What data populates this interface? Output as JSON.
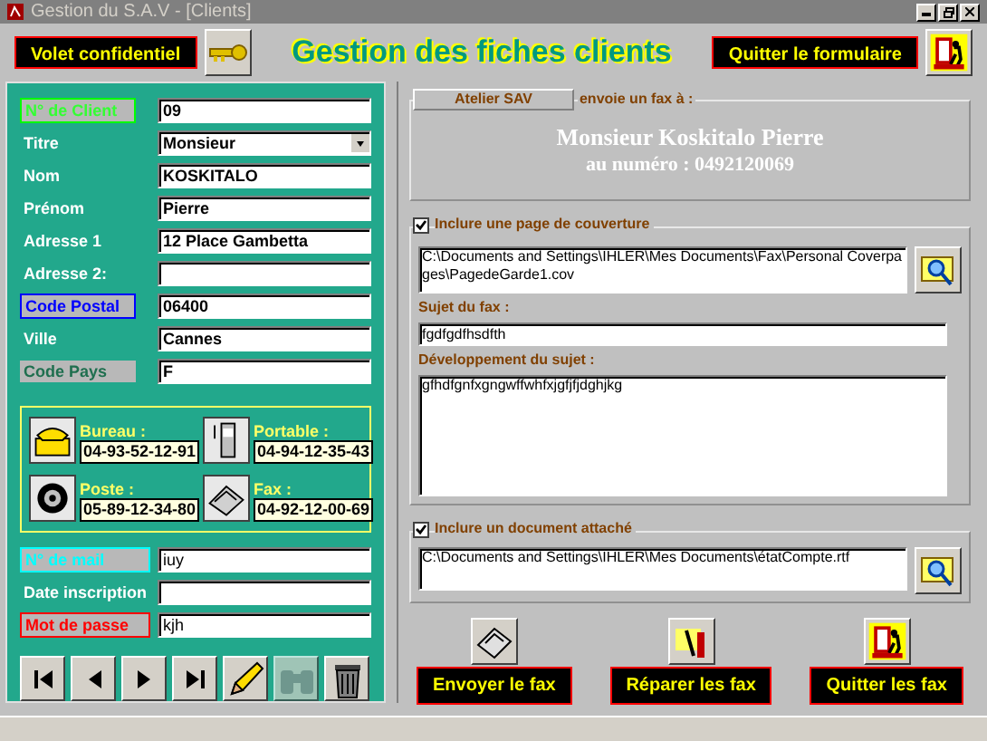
{
  "window": {
    "title": "Gestion du S.A.V - [Clients]"
  },
  "header": {
    "confidential_button": "Volet confidentiel",
    "title": "Gestion des fiches clients",
    "quit_button": "Quitter le formulaire"
  },
  "client_form": {
    "fields": [
      {
        "label": "N° de Client",
        "kind": "id",
        "value": "09"
      },
      {
        "label": "Titre",
        "kind": "select",
        "value": "Monsieur"
      },
      {
        "label": "Nom",
        "kind": "text",
        "value": "KOSKITALO"
      },
      {
        "label": "Prénom",
        "kind": "text",
        "value": "Pierre"
      },
      {
        "label": "Adresse 1",
        "kind": "text",
        "value": "12 Place Gambetta"
      },
      {
        "label": "Adresse 2:",
        "kind": "text"
      },
      {
        "label": "Code Postal",
        "kind": "postal",
        "value": "06400"
      },
      {
        "label": "Ville",
        "kind": "text",
        "value": "Cannes"
      },
      {
        "label": "Code Pays",
        "kind": "country",
        "value": "F"
      }
    ],
    "phones": [
      {
        "kind": "desk",
        "label": "Bureau :",
        "number": "04-93-52-12-91"
      },
      {
        "kind": "mobile",
        "label": "Portable :",
        "number": "04-94-12-35-43"
      },
      {
        "kind": "extension",
        "label": "Poste :",
        "number": "05-89-12-34-80"
      },
      {
        "kind": "fax",
        "label": "Fax :",
        "number": "04-92-12-00-69"
      }
    ],
    "extra_fields": [
      {
        "label": "N° de mail",
        "kind": "mail",
        "value": "iuy"
      },
      {
        "label": "Date inscription",
        "kind": "text"
      },
      {
        "label": "Mot de passe",
        "kind": "password",
        "value": "kjh"
      }
    ],
    "nav_buttons": [
      {
        "kind": "first"
      },
      {
        "kind": "prev"
      },
      {
        "kind": "next"
      },
      {
        "kind": "last"
      },
      {
        "kind": "edit"
      },
      {
        "kind": "find",
        "disabled": true
      },
      {
        "kind": "delete"
      }
    ]
  },
  "fax_panel": {
    "sender": "Atelier SAV",
    "sender_suffix": "envoie un fax à :",
    "recipient": "Monsieur Koskitalo Pierre",
    "number_line": "au numéro : 0492120069",
    "cover_page": {
      "label": "Inclure une page de couverture",
      "checked": true,
      "path": "C:\\Documents and Settings\\IHLER\\Mes Documents\\Fax\\Personal Coverpages\\PagedeGarde1.cov"
    },
    "subject": {
      "label": "Sujet du fax :",
      "value": "fgdfgdfhsdfth"
    },
    "body": {
      "label": "Développement du sujet :",
      "value": "gfhdfgnfxgngwffwhfxjgfjfjdghjkg"
    },
    "attachment": {
      "label": "Inclure un document attaché",
      "checked": true,
      "path": "C:\\Documents and Settings\\IHLER\\Mes Documents\\étatCompte.rtf"
    },
    "actions": [
      {
        "kind": "send",
        "label": "Envoyer le fax"
      },
      {
        "kind": "repair",
        "label": "Réparer les fax"
      },
      {
        "kind": "quit",
        "label": "Quitter les fax"
      }
    ]
  }
}
